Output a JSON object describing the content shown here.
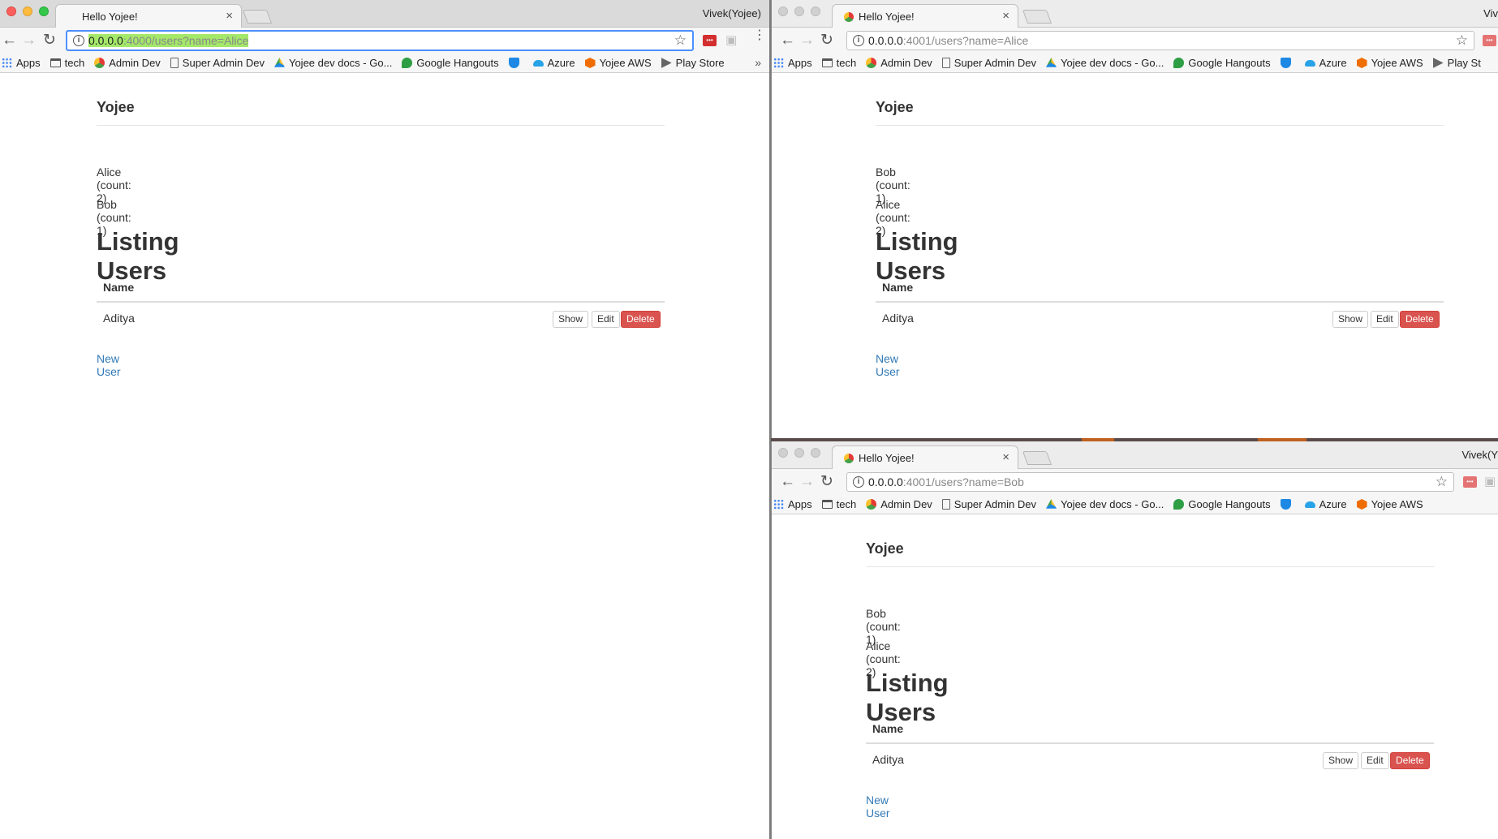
{
  "browser": {
    "tab_title": "Hello Yojee!",
    "profile_full": "Vivek(Yojee)",
    "profile_trunc_top": "Viv",
    "profile_trunc_bottom": "Vivek(Y",
    "close_glyph": "×",
    "bookmarks_overflow": "»",
    "bookmarks": [
      {
        "label": "Apps",
        "icon": "apps-grid-icon"
      },
      {
        "label": "tech",
        "icon": "folder-icon"
      },
      {
        "label": "Admin Dev",
        "icon": "yojee-icon"
      },
      {
        "label": "Super Admin Dev",
        "icon": "page-icon"
      },
      {
        "label": "Yojee dev docs - Go...",
        "icon": "google-drive-icon"
      },
      {
        "label": "Google Hangouts",
        "icon": "hangouts-icon"
      },
      {
        "label": "",
        "icon": "shield-icon"
      },
      {
        "label": "Azure",
        "icon": "cloud-icon"
      },
      {
        "label": "Yojee AWS",
        "icon": "aws-icon"
      },
      {
        "label": "Play Store",
        "icon": "play-store-icon"
      }
    ],
    "bookmarks_short_top": {
      "play_label": "Play St"
    }
  },
  "windows": {
    "left": {
      "url_host": "0.0.0.0",
      "url_rest": ":4000/users?name=Alice",
      "flash": [
        "Alice (count: 2)",
        "Bob (count: 1)"
      ]
    },
    "top_right": {
      "url_host": "0.0.0.0",
      "url_rest": ":4001/users?name=Alice",
      "flash": [
        "Bob (count: 1)",
        "Alice (count: 2)"
      ]
    },
    "bottom_right": {
      "url_host": "0.0.0.0",
      "url_rest": ":4001/users?name=Bob",
      "flash": [
        "Bob (count: 1)",
        "Alice (count: 2)"
      ]
    }
  },
  "page": {
    "brand": "Yojee",
    "heading": "Listing Users",
    "table_header": "Name",
    "rows": [
      {
        "name": "Aditya"
      }
    ],
    "actions": {
      "show": "Show",
      "edit": "Edit",
      "delete": "Delete"
    },
    "new_user": "New User"
  },
  "colors": {
    "link": "#337ab7",
    "danger": "#d9534f",
    "focus_ring": "#4d90fe",
    "url_selection": "#a4e86a"
  }
}
